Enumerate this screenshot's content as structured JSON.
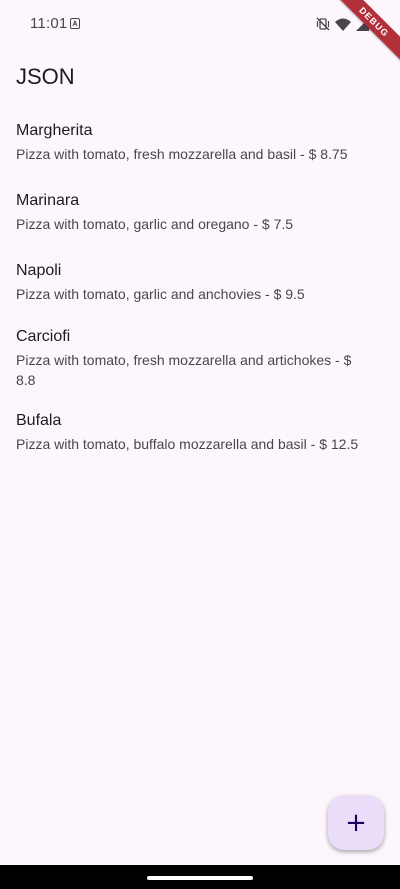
{
  "status_bar": {
    "time": "11:01",
    "icons": [
      "notification-a-icon",
      "vibrate-off-icon",
      "wifi-icon",
      "signal-icon",
      "battery-icon"
    ]
  },
  "debug_banner": {
    "label": "DEBUG"
  },
  "app_bar": {
    "title": "JSON"
  },
  "pizzas": [
    {
      "name": "Margherita",
      "description": "Pizza with tomato, fresh mozzarella and basil - $ 8.75"
    },
    {
      "name": "Marinara",
      "description": "Pizza with tomato, garlic and oregano - $ 7.5"
    },
    {
      "name": "Napoli",
      "description": "Pizza with tomato, garlic and anchovies - $ 9.5"
    },
    {
      "name": "Carciofi",
      "description": "Pizza with tomato, fresh mozzarella and artichokes - $ 8.8"
    },
    {
      "name": "Bufala",
      "description": "Pizza with tomato, buffalo mozzarella and basil - $ 12.5"
    }
  ],
  "fab": {
    "icon": "add-icon",
    "glyph": "+"
  },
  "colors": {
    "background": "#fdf7fd",
    "fab_background": "#e9ddfa",
    "debug_ribbon": "#b1303a"
  }
}
